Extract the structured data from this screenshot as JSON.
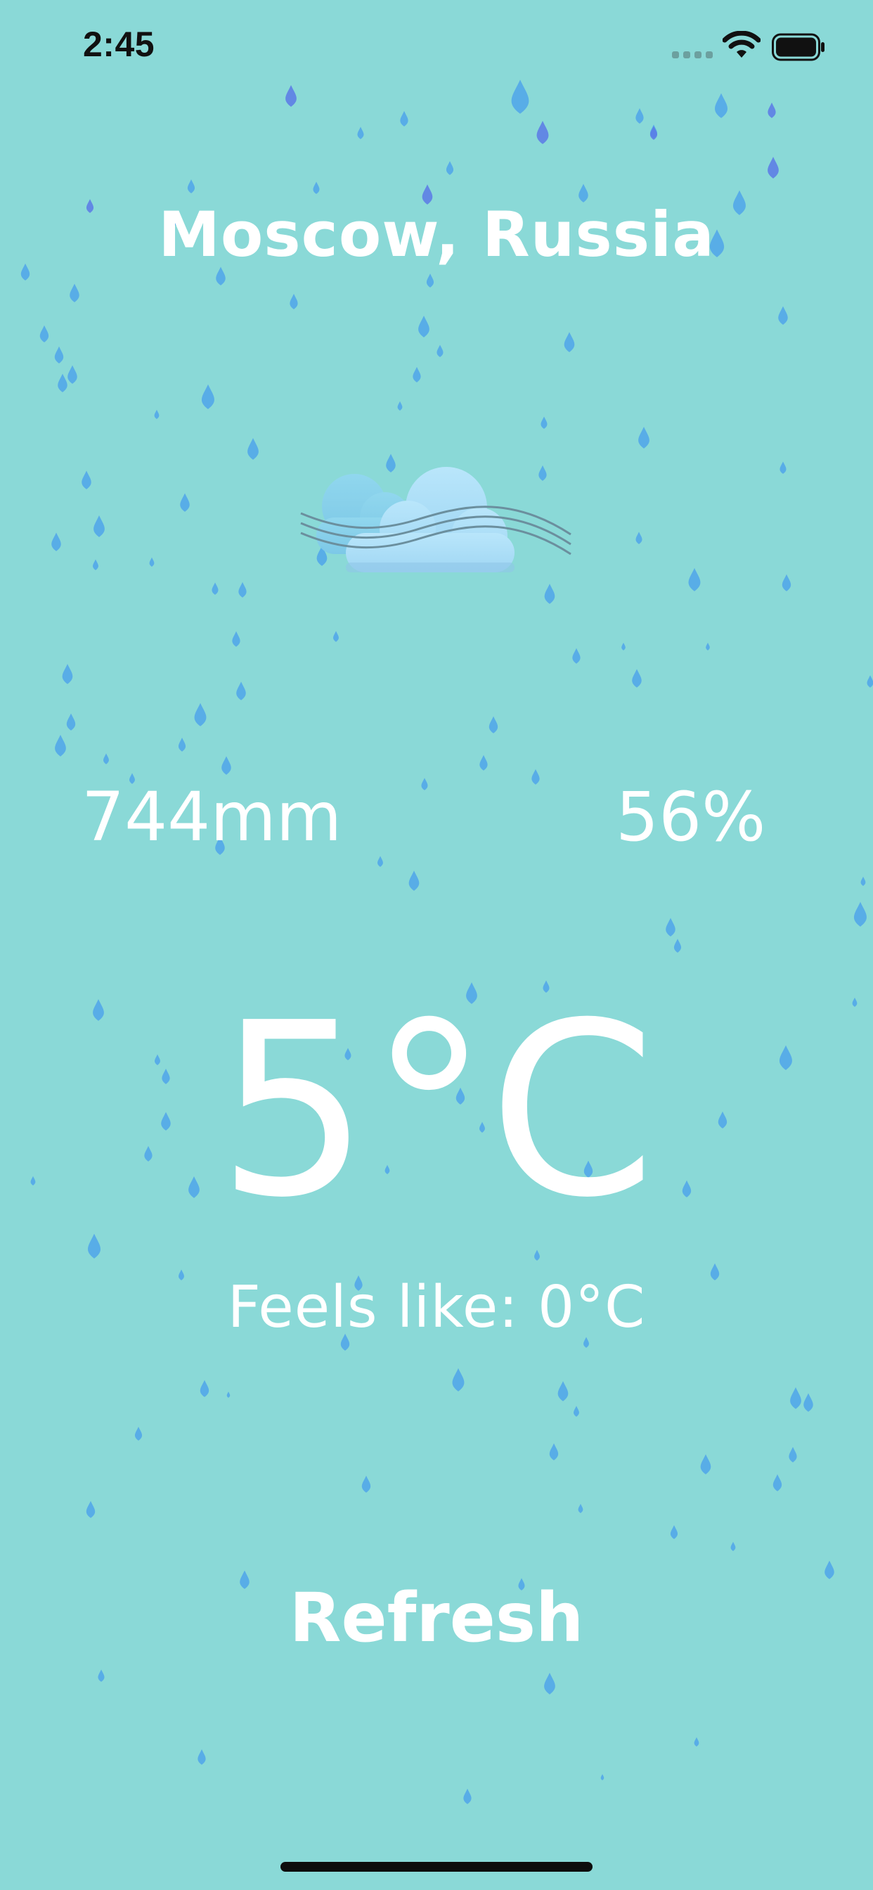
{
  "status_bar": {
    "time": "2:45",
    "icons": [
      "signal-icon",
      "wifi-icon",
      "battery-icon"
    ]
  },
  "location": {
    "city": "Moscow, Russia"
  },
  "weather": {
    "condition_icon": "cloud-wind-icon",
    "pressure": "744mm",
    "humidity": "56%",
    "temperature": "5°C",
    "feels_like": "Feels like: 0°C"
  },
  "actions": {
    "refresh_label": "Refresh"
  },
  "colors": {
    "background": "#8ad9d7",
    "text": "#ffffff",
    "raindrop": "#4fa5ea",
    "raindrop_dark": "#5b79e6",
    "cloud": "#a9ddf6"
  }
}
